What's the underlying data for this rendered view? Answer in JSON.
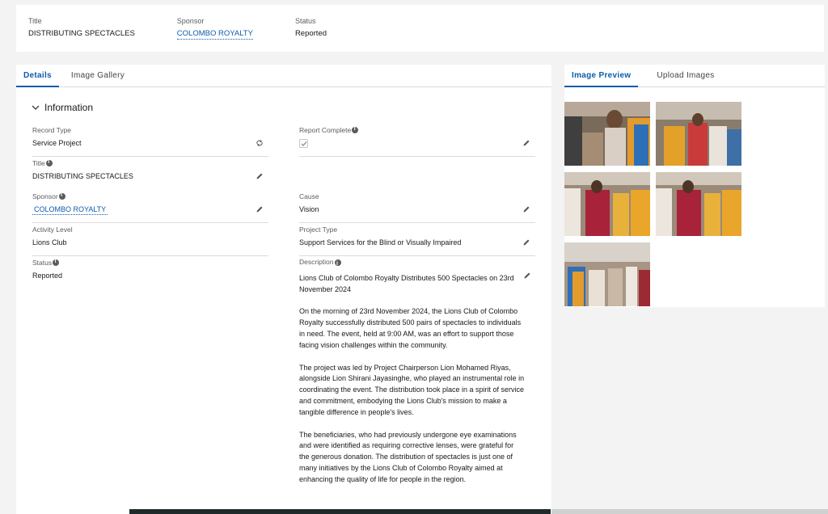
{
  "highlights": {
    "title_label": "Title",
    "title_value": "DISTRIBUTING SPECTACLES",
    "sponsor_label": "Sponsor",
    "sponsor_value": "COLOMBO ROYALTY",
    "status_label": "Status",
    "status_value": "Reported"
  },
  "left_tabs": [
    "Details",
    "Image Gallery"
  ],
  "right_tabs": [
    "Image Preview",
    "Upload Images"
  ],
  "section_title": "Information",
  "fields": {
    "record_type_label": "Record Type",
    "record_type_value": "Service Project",
    "report_complete_label": "Report Complete",
    "title_label": "Title",
    "title_value": "DISTRIBUTING SPECTACLES",
    "sponsor_label": "Sponsor",
    "sponsor_value": "COLOMBO ROYALTY",
    "cause_label": "Cause",
    "cause_value": "Vision",
    "activity_level_label": "Activity Level",
    "activity_level_value": "Lions Club",
    "project_type_label": "Project Type",
    "project_type_value": "Support Services for the Blind or Visually Impaired",
    "status_label": "Status",
    "status_value": "Reported",
    "description_label": "Description"
  },
  "description": [
    "Lions Club of Colombo Royalty Distributes 500 Spectacles on 23rd November 2024",
    "On the morning of 23rd November 2024, the Lions Club of Colombo Royalty successfully distributed 500 pairs of spectacles to individuals in need. The event, held at 9:00 AM, was an effort to support those facing vision challenges within the community.",
    "The project was led by Project Chairperson Lion Mohamed Riyas, alongside Lion Shirani Jayasinghe, who played an instrumental role in coordinating the event. The distribution took place in a spirit of service and commitment, embodying the Lions Club's mission to make a tangible difference in people's lives.",
    "The beneficiaries, who had previously undergone eye examinations and were identified as requiring corrective lenses, were grateful for the generous donation. The distribution of spectacles is just one of many initiatives by the Lions Club of Colombo Royalty aimed at enhancing the quality of life for people in the region."
  ],
  "colors": {
    "accent": "#0b5cab",
    "panel": "#ffffff",
    "background": "#f3f3f3"
  }
}
